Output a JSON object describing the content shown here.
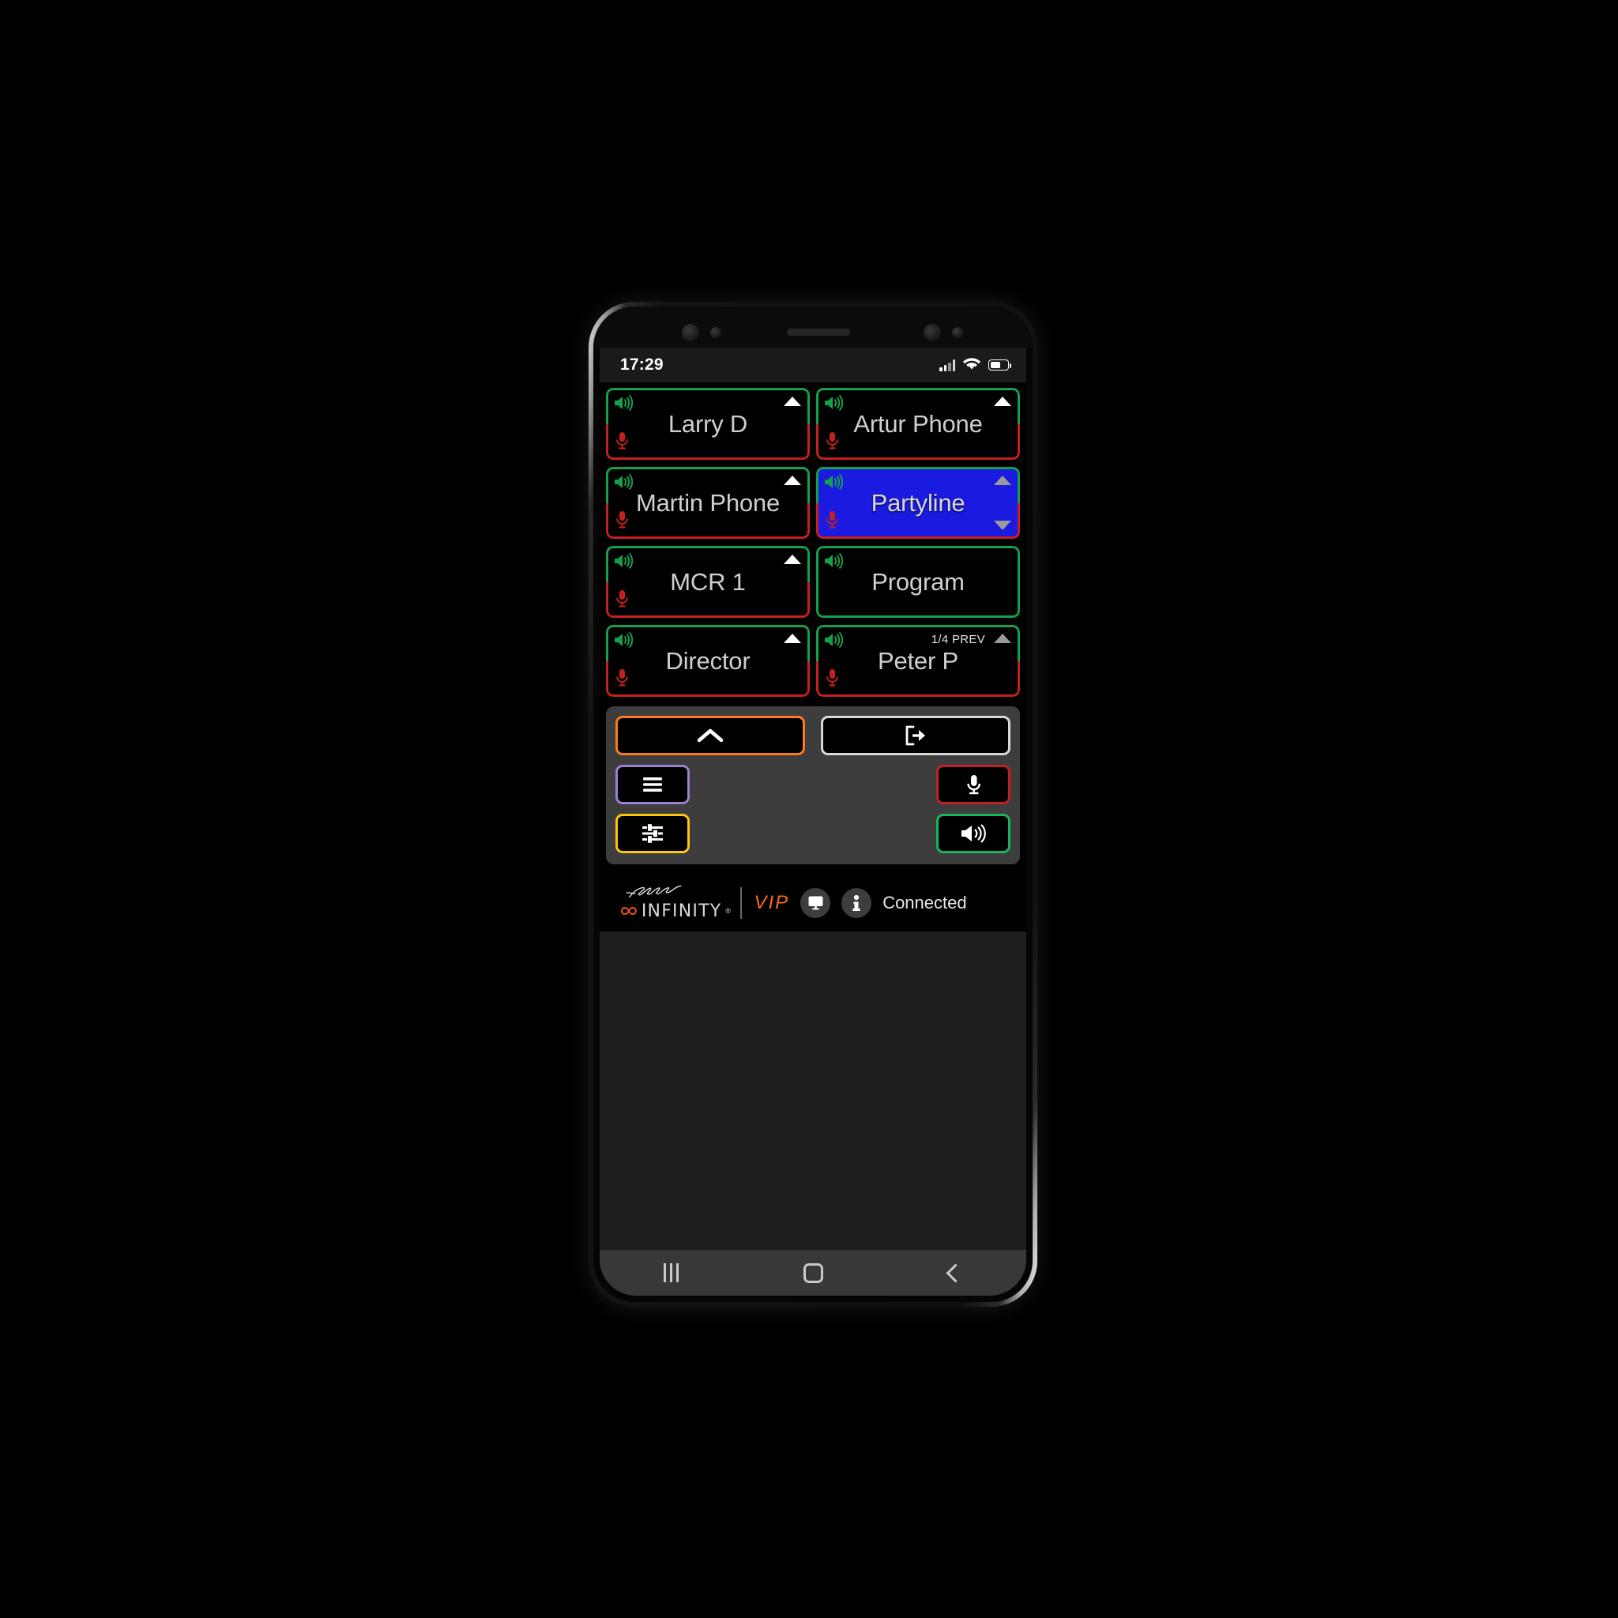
{
  "status_bar": {
    "time": "17:29",
    "icons": [
      "signal-icon",
      "wifi-icon",
      "battery-icon"
    ]
  },
  "colors": {
    "listen_green": "#15a04a",
    "talk_red": "#c42020",
    "active_blue": "#1a1ae0",
    "accent_orange": "#ff7a18",
    "brand_orange": "#ff6a13",
    "purple": "#a07ed0",
    "yellow": "#ffc40d",
    "panel_gray": "#3d3d3d",
    "label_gray": "#cfcfcf"
  },
  "buttons": [
    {
      "label": "Larry D",
      "state": "idle",
      "listen": true,
      "talk": true,
      "arrow_up": "white",
      "arrow_down": false,
      "prev": ""
    },
    {
      "label": "Artur Phone",
      "state": "idle",
      "listen": true,
      "talk": true,
      "arrow_up": "white",
      "arrow_down": false,
      "prev": ""
    },
    {
      "label": "Martin Phone",
      "state": "idle",
      "listen": true,
      "talk": true,
      "arrow_up": "white",
      "arrow_down": false,
      "prev": ""
    },
    {
      "label": "Partyline",
      "state": "active",
      "listen": true,
      "talk": true,
      "arrow_up": "gray",
      "arrow_down": true,
      "prev": ""
    },
    {
      "label": "MCR 1",
      "state": "idle",
      "listen": true,
      "talk": true,
      "arrow_up": "white",
      "arrow_down": false,
      "prev": ""
    },
    {
      "label": "Program",
      "state": "listen-only",
      "listen": true,
      "talk": false,
      "arrow_up": "none",
      "arrow_down": false,
      "prev": ""
    },
    {
      "label": "Director",
      "state": "idle",
      "listen": true,
      "talk": true,
      "arrow_up": "white",
      "arrow_down": false,
      "prev": ""
    },
    {
      "label": "Peter P",
      "state": "idle",
      "listen": true,
      "talk": true,
      "arrow_up": "gray",
      "arrow_down": false,
      "prev": "1/4 PREV"
    }
  ],
  "control_panel": {
    "collapse_button": "chevron-up-icon",
    "logout_button": "exit-icon",
    "menu_button": "hamburger-menu-icon",
    "mic_button": "microphone-icon",
    "settings_button": "sliders-icon",
    "speaker_button": "speaker-icon"
  },
  "footer": {
    "brand_script": "Telos",
    "brand_word": "INFINITY",
    "brand_reg": "®",
    "product": "VIP",
    "monitor_icon": "monitor-icon",
    "info_icon": "info-icon",
    "status": "Connected"
  },
  "navbar": {
    "recents": "recents-icon",
    "home": "home-icon",
    "back": "back-icon"
  }
}
